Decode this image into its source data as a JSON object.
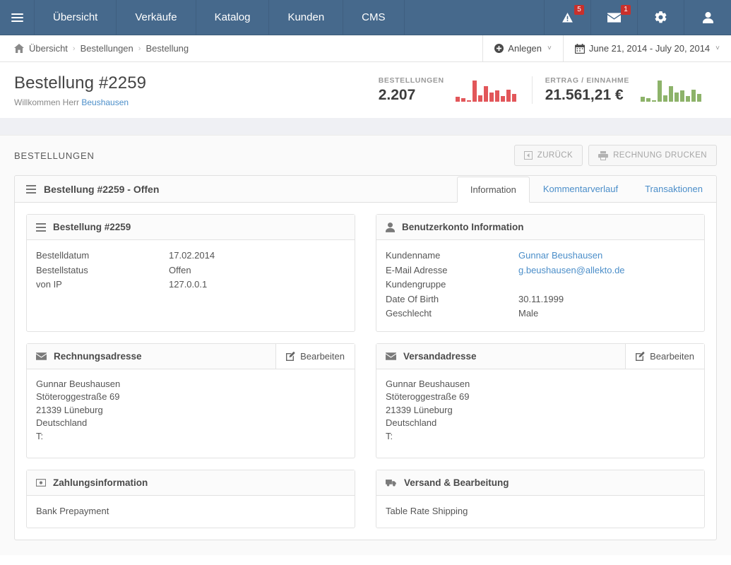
{
  "topnav": {
    "burger": "menu-icon",
    "items": [
      {
        "label": "Übersicht"
      },
      {
        "label": "Verkäufe"
      },
      {
        "label": "Katalog"
      },
      {
        "label": "Kunden"
      },
      {
        "label": "CMS"
      }
    ],
    "icons": [
      {
        "name": "warning-icon",
        "badge": "5"
      },
      {
        "name": "envelope-icon",
        "badge": "1"
      },
      {
        "name": "gear-icon",
        "badge": ""
      },
      {
        "name": "user-icon",
        "badge": ""
      }
    ]
  },
  "breadcrumb": {
    "home": "home-icon",
    "items": [
      "Übersicht",
      "Bestellungen",
      "Bestellung"
    ],
    "separator": "›",
    "actions": [
      {
        "label": "Anlegen",
        "icon": "plus-circle-icon",
        "caret": "˅"
      },
      {
        "label": "June 21, 2014 - July 20, 2014",
        "icon": "calendar-icon",
        "caret": "˅"
      }
    ]
  },
  "page_header": {
    "title": "Bestellung #2259",
    "welcome_prefix": "Willkommen Herr ",
    "welcome_user": "Beushausen",
    "stats": [
      {
        "label": "BESTELLUNGEN",
        "value": "2.207",
        "color": "#e2575a",
        "spark": [
          22,
          17,
          6,
          100,
          30,
          72,
          42,
          52,
          28,
          56,
          38
        ]
      },
      {
        "label": "ERTRAG / EINNAHME",
        "value": "21.561,21 €",
        "color": "#8db36a",
        "spark": [
          22,
          17,
          6,
          100,
          30,
          72,
          42,
          52,
          28,
          56,
          38
        ]
      }
    ]
  },
  "content": {
    "title": "BESTELLUNGEN",
    "buttons": [
      {
        "label": "ZURÜCK",
        "icon": "back-arrow-icon"
      },
      {
        "label": "RECHNUNG DRUCKEN",
        "icon": "printer-icon"
      }
    ]
  },
  "main_panel": {
    "title": "Bestellung #2259 - Offen",
    "tabs": [
      {
        "label": "Information",
        "active": true
      },
      {
        "label": "Kommentarverlauf",
        "active": false
      },
      {
        "label": "Transaktionen",
        "active": false
      }
    ]
  },
  "order_info": {
    "title": "Bestellung #2259",
    "icon": "menu-icon",
    "rows": [
      {
        "key": "Bestelldatum",
        "value": "17.02.2014"
      },
      {
        "key": "Bestellstatus",
        "value": "Offen"
      },
      {
        "key": "von IP",
        "value": "127.0.0.1"
      }
    ]
  },
  "account_info": {
    "title": "Benutzerkonto Information",
    "icon": "user-icon",
    "rows": [
      {
        "key": "Kundenname",
        "value": "Gunnar Beushausen",
        "link": true
      },
      {
        "key": "E-Mail Adresse",
        "value": "g.beushausen@allekto.de",
        "link": true
      },
      {
        "key": "Kundengruppe",
        "value": "",
        "link": false
      },
      {
        "key": "Date Of Birth",
        "value": "30.11.1999",
        "link": false
      },
      {
        "key": "Geschlecht",
        "value": "Male",
        "link": false
      }
    ]
  },
  "billing_address": {
    "title": "Rechnungsadresse",
    "icon": "envelope-icon",
    "edit_label": "Bearbeiten",
    "edit_icon": "pencil-square-icon",
    "lines": [
      "Gunnar Beushausen",
      "Stöteroggestraße 69",
      "21339 Lüneburg",
      "Deutschland",
      "T:"
    ]
  },
  "shipping_address": {
    "title": "Versandadresse",
    "icon": "envelope-icon",
    "edit_label": "Bearbeiten",
    "edit_icon": "pencil-square-icon",
    "lines": [
      "Gunnar Beushausen",
      "Stöteroggestraße 69",
      "21339 Lüneburg",
      "Deutschland",
      "T:"
    ]
  },
  "payment_info": {
    "title": "Zahlungsinformation",
    "icon": "money-icon",
    "text": "Bank Prepayment"
  },
  "shipping_info": {
    "title": "Versand & Bearbeitung",
    "icon": "truck-icon",
    "text": "Table Rate Shipping"
  },
  "colors": {
    "nav": "#46698c",
    "link": "#4b8ec9",
    "badge": "#c9302c",
    "orders_spark": "#e2575a",
    "revenue_spark": "#8db36a"
  }
}
